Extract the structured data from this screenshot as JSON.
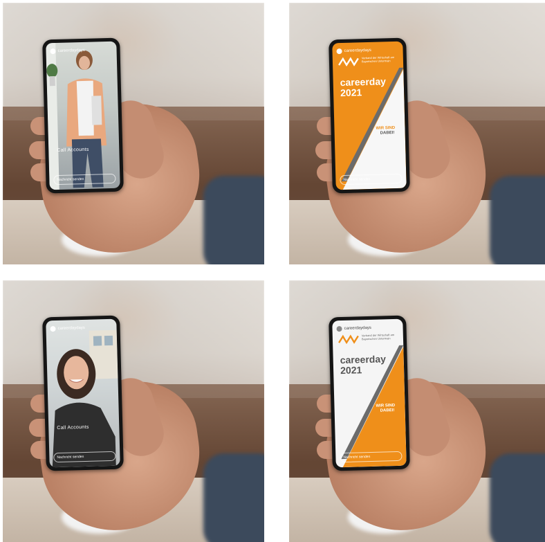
{
  "panels": [
    {
      "account": "careerdaydays",
      "caption": "Call Accounts",
      "footer": "Nachricht senden"
    },
    {
      "account": "careerdaydays",
      "logo_sub": "Verband der Wirtschaft am Bayerischen Untermain",
      "headline_1": "careerday",
      "headline_2": "2021",
      "slogan_1": "WIR SIND",
      "slogan_2": "DABEI!",
      "footer": "Nachricht senden"
    },
    {
      "account": "careerdaydays",
      "caption": "Call Accounts",
      "footer": "Nachricht senden"
    },
    {
      "account": "careerdaydays",
      "logo_sub": "Verband der Wirtschaft am Bayerischen Untermain",
      "headline_1": "careerday",
      "headline_2": "2021",
      "slogan_1": "WIR SIND",
      "slogan_2": "DABEI!",
      "footer": "Nachricht senden"
    }
  ],
  "colors": {
    "accent_orange": "#ef8f1a",
    "phone_body": "#151515"
  }
}
